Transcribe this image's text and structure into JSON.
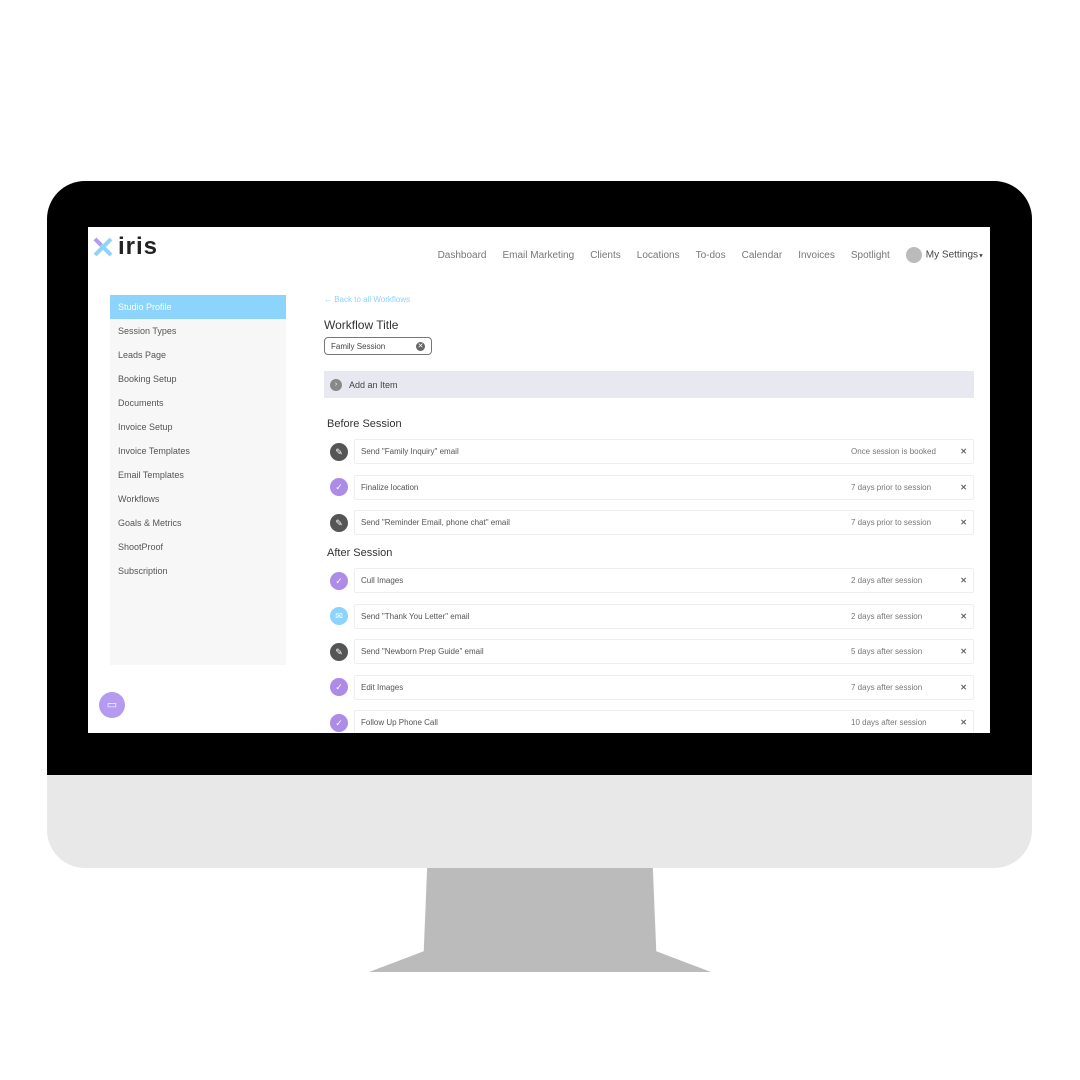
{
  "brand": {
    "name": "iris",
    "colors": {
      "accent": "#8dd4fd",
      "purple": "#ad8ce8",
      "dark": "#555555"
    }
  },
  "nav": {
    "items": [
      "Dashboard",
      "Email Marketing",
      "Clients",
      "Locations",
      "To-dos",
      "Calendar",
      "Invoices",
      "Spotlight"
    ],
    "settings": "My Settings"
  },
  "sidebar": {
    "items": [
      "Studio Profile",
      "Session Types",
      "Leads Page",
      "Booking Setup",
      "Documents",
      "Invoice Setup",
      "Invoice Templates",
      "Email Templates",
      "Workflows",
      "Goals & Metrics",
      "ShootProof",
      "Subscription"
    ],
    "active": "Studio Profile"
  },
  "main": {
    "back": "← Back to all Workflows",
    "title_label": "Workflow Title",
    "title_value": "Family Session",
    "add_item": "Add an Item",
    "sections": [
      {
        "title": "Before Session",
        "items": [
          {
            "icon": "edit-icon",
            "label": "Send \"Family Inquiry\" email",
            "when": "Once session is booked"
          },
          {
            "icon": "check-icon",
            "label": "Finalize location",
            "when": "7 days prior to session"
          },
          {
            "icon": "edit-icon",
            "label": "Send \"Reminder Email, phone chat\" email",
            "when": "7 days prior to session"
          }
        ]
      },
      {
        "title": "After Session",
        "items": [
          {
            "icon": "check-icon",
            "label": "Cull Images",
            "when": "2 days after session"
          },
          {
            "icon": "mail-icon",
            "label": "Send \"Thank You Letter\" email",
            "when": "2 days after session"
          },
          {
            "icon": "edit-icon",
            "label": "Send \"Newborn Prep Guide\" email",
            "when": "5 days after session"
          },
          {
            "icon": "check-icon",
            "label": "Edit Images",
            "when": "7 days after session"
          },
          {
            "icon": "check-icon",
            "label": "Follow Up Phone Call",
            "when": "10 days after session"
          }
        ]
      }
    ]
  }
}
